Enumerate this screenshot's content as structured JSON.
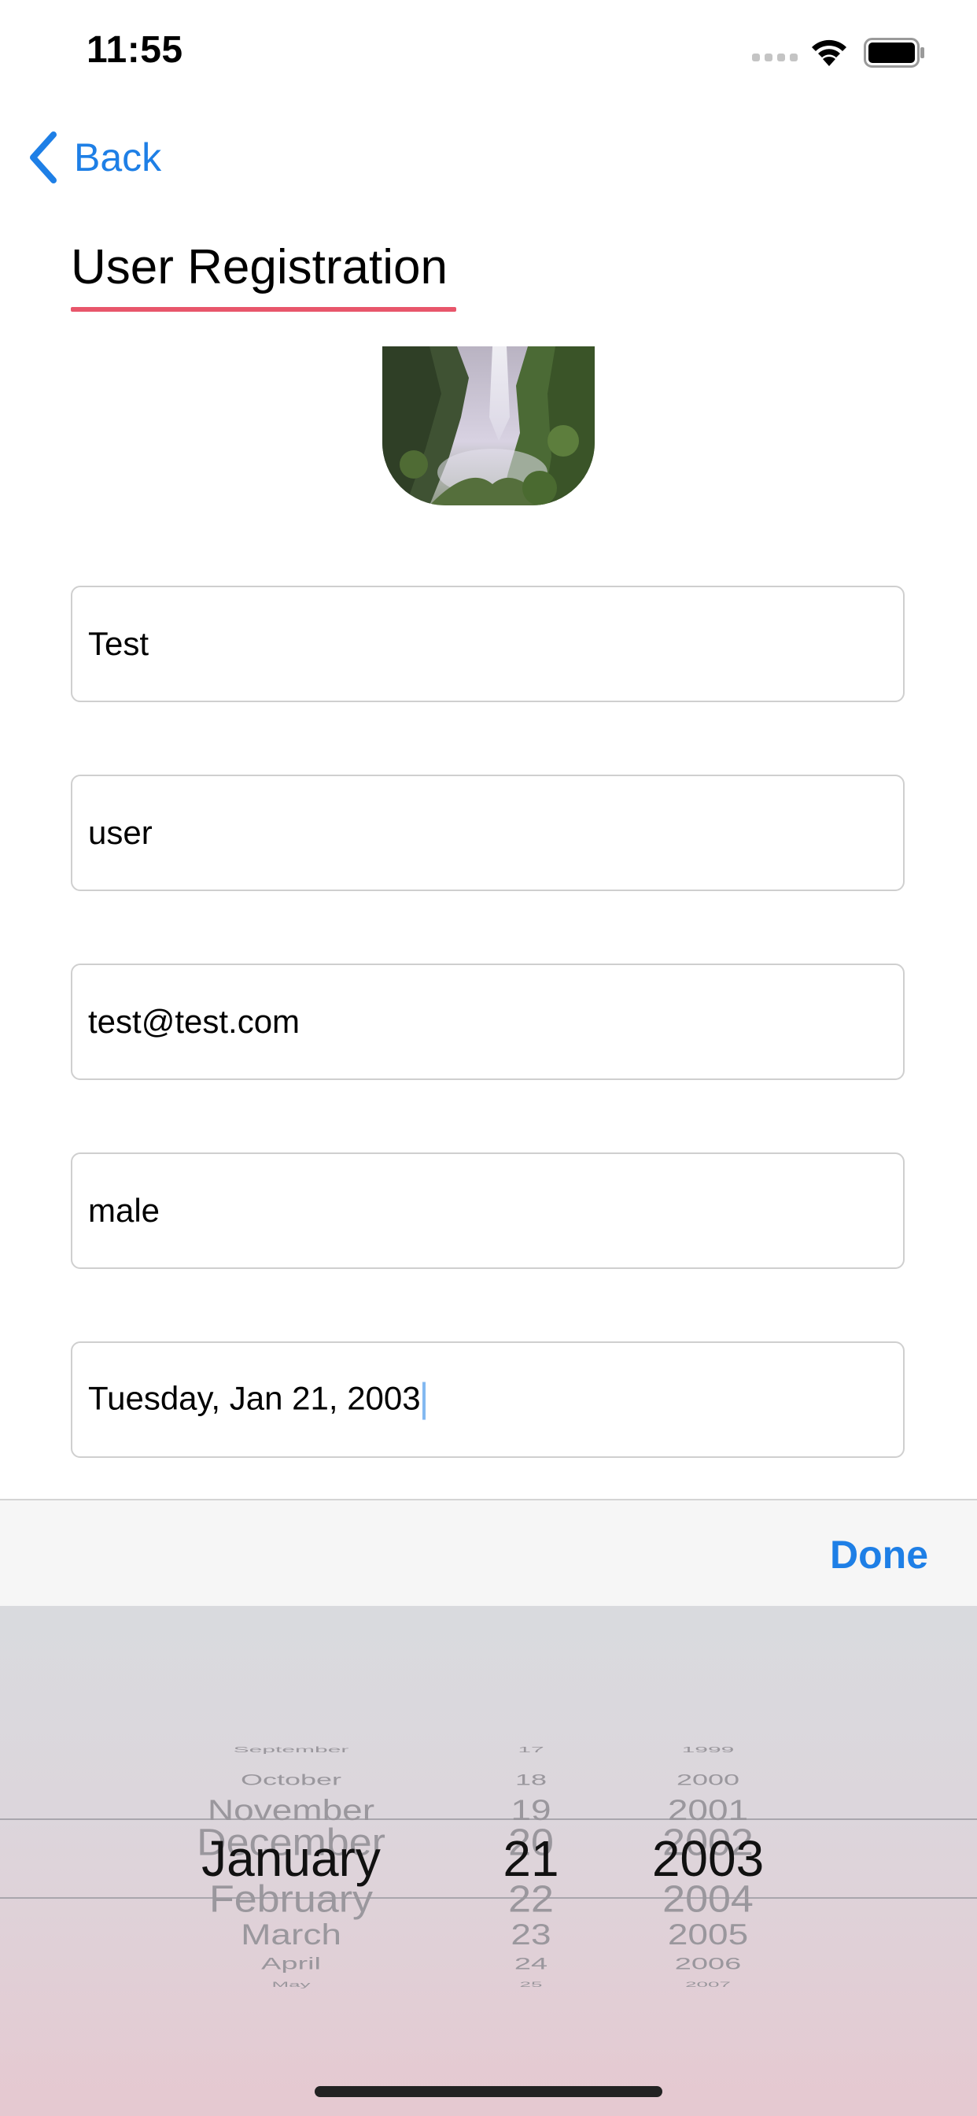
{
  "status_bar": {
    "time": "11:55"
  },
  "nav": {
    "back_label": "Back"
  },
  "header": {
    "title": "User Registration"
  },
  "form": {
    "fields": [
      {
        "value": "Test"
      },
      {
        "value": "user"
      },
      {
        "value": "test@test.com"
      },
      {
        "value": "male"
      },
      {
        "value": "Tuesday, Jan 21, 2003"
      }
    ]
  },
  "toolbar": {
    "done_label": "Done"
  },
  "date_picker": {
    "months": [
      "September",
      "October",
      "November",
      "December",
      "January",
      "February",
      "March",
      "April",
      "May"
    ],
    "days": [
      "17",
      "18",
      "19",
      "20",
      "21",
      "22",
      "23",
      "24",
      "25"
    ],
    "years": [
      "1999",
      "2000",
      "2001",
      "2002",
      "2003",
      "2004",
      "2005",
      "2006",
      "2007"
    ],
    "selected": {
      "month": "January",
      "day": "21",
      "year": "2003"
    }
  },
  "colors": {
    "accent": "#1e7fe6",
    "title_underline": "#e8566b"
  }
}
